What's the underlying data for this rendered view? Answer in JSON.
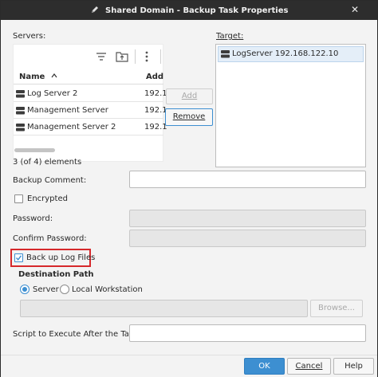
{
  "window": {
    "title": "Shared Domain - Backup Task Properties",
    "title_icon": "pen-icon",
    "close_glyph": "✕"
  },
  "servers": {
    "label": "Servers:",
    "columns": {
      "name": "Name",
      "sort_indicator": "^",
      "address": "Add"
    },
    "rows": [
      {
        "name": "Log Server 2",
        "address": "192.1"
      },
      {
        "name": "Management Server",
        "address": "192.1"
      },
      {
        "name": "Management Server 2",
        "address": "192.1"
      }
    ],
    "count_text": "3 (of 4) elements"
  },
  "target": {
    "label": "Target:",
    "items": [
      {
        "name": "LogServer 192.168.122.10"
      }
    ]
  },
  "buttons": {
    "add": "Add",
    "remove": "Remove",
    "browse": "Browse...",
    "ok": "OK",
    "cancel": "Cancel",
    "help": "Help"
  },
  "form": {
    "backup_comment_label": "Backup Comment:",
    "backup_comment_value": "",
    "encrypted_label": "Encrypted",
    "encrypted_checked": false,
    "password_label": "Password:",
    "confirm_password_label": "Confirm Password:",
    "backup_log_files_label": "Back up Log Files",
    "backup_log_files_checked": true,
    "destination_path_label": "Destination Path",
    "radio_server_label": "Server",
    "radio_local_label": "Local Workstation",
    "selected_destination": "Server",
    "path_value": "",
    "script_label": "Script to Execute After the Task:",
    "script_value": ""
  },
  "colors": {
    "accent": "#3d8fd1",
    "highlight_border": "#d6282b",
    "titlebar": "#2d2d2d"
  }
}
